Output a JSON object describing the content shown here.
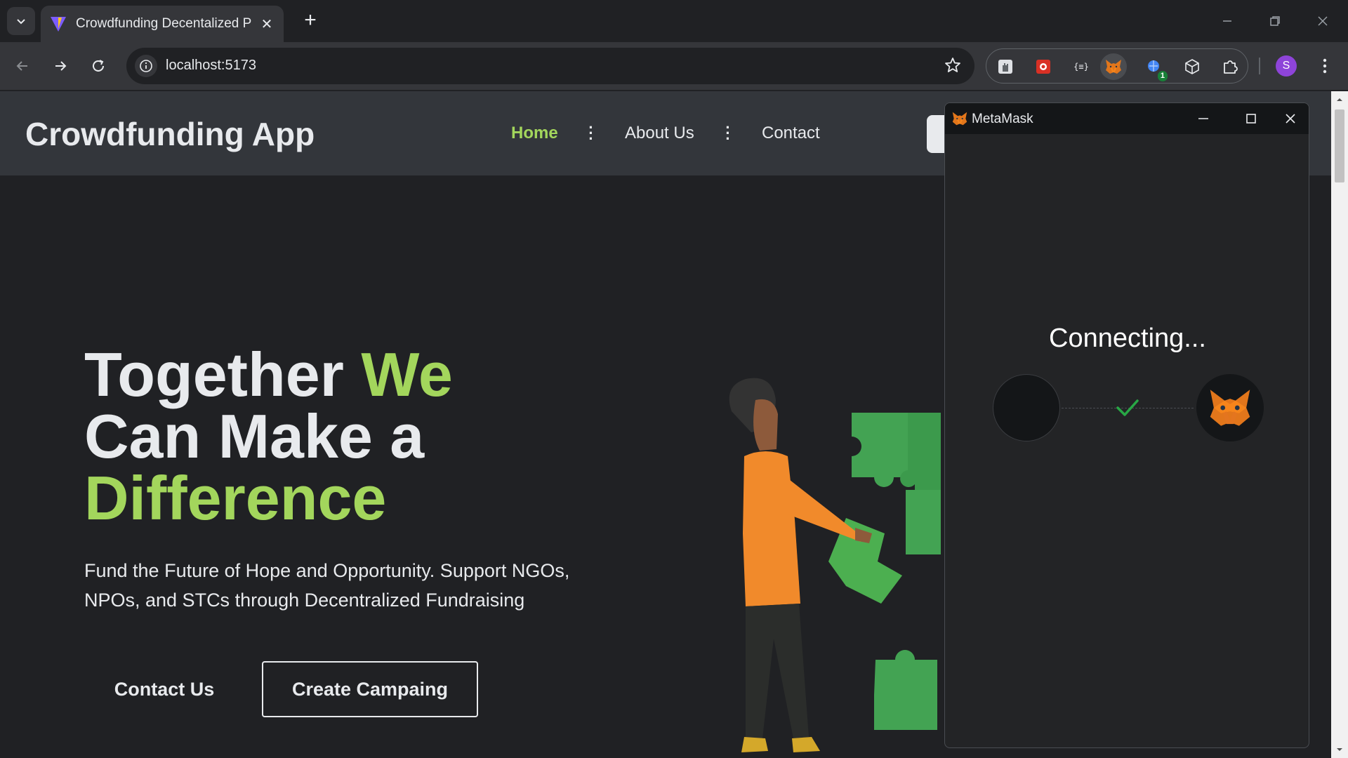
{
  "browser": {
    "tab_title": "Crowdfunding Decentalized Pla",
    "url": "localhost:5173",
    "profile_initial": "S",
    "extension_badge": "1",
    "icons": {
      "tab_search": "chevron-down-icon",
      "close_tab": "close-icon",
      "new_tab": "plus-icon",
      "back": "arrow-left-icon",
      "forward": "arrow-right-icon",
      "reload": "reload-icon",
      "site_info": "info-icon",
      "bookmark": "star-icon",
      "menu": "kebab-icon"
    }
  },
  "site": {
    "brand": "Crowdfunding App",
    "nav": [
      {
        "label": "Home",
        "active": true
      },
      {
        "label": "About Us",
        "active": false
      },
      {
        "label": "Contact",
        "active": false
      }
    ],
    "hero": {
      "title_1": "Together ",
      "title_accent_1": "We",
      "title_2": "Can Make a",
      "title_accent_2": "Difference",
      "subtitle": "Fund the Future of Hope and Opportunity. Support NGOs, NPOs, and STCs through Decentralized Fundraising"
    },
    "buttons": {
      "contact": "Contact Us",
      "create": "Create Campaing"
    },
    "colors": {
      "accent": "#a3d65c",
      "background": "#202124",
      "header": "#33363b"
    }
  },
  "metamask": {
    "title": "MetaMask",
    "status": "Connecting...",
    "icons": {
      "minimize": "minimize-icon",
      "maximize": "maximize-icon",
      "close": "close-icon",
      "check": "checkmark-icon"
    }
  }
}
